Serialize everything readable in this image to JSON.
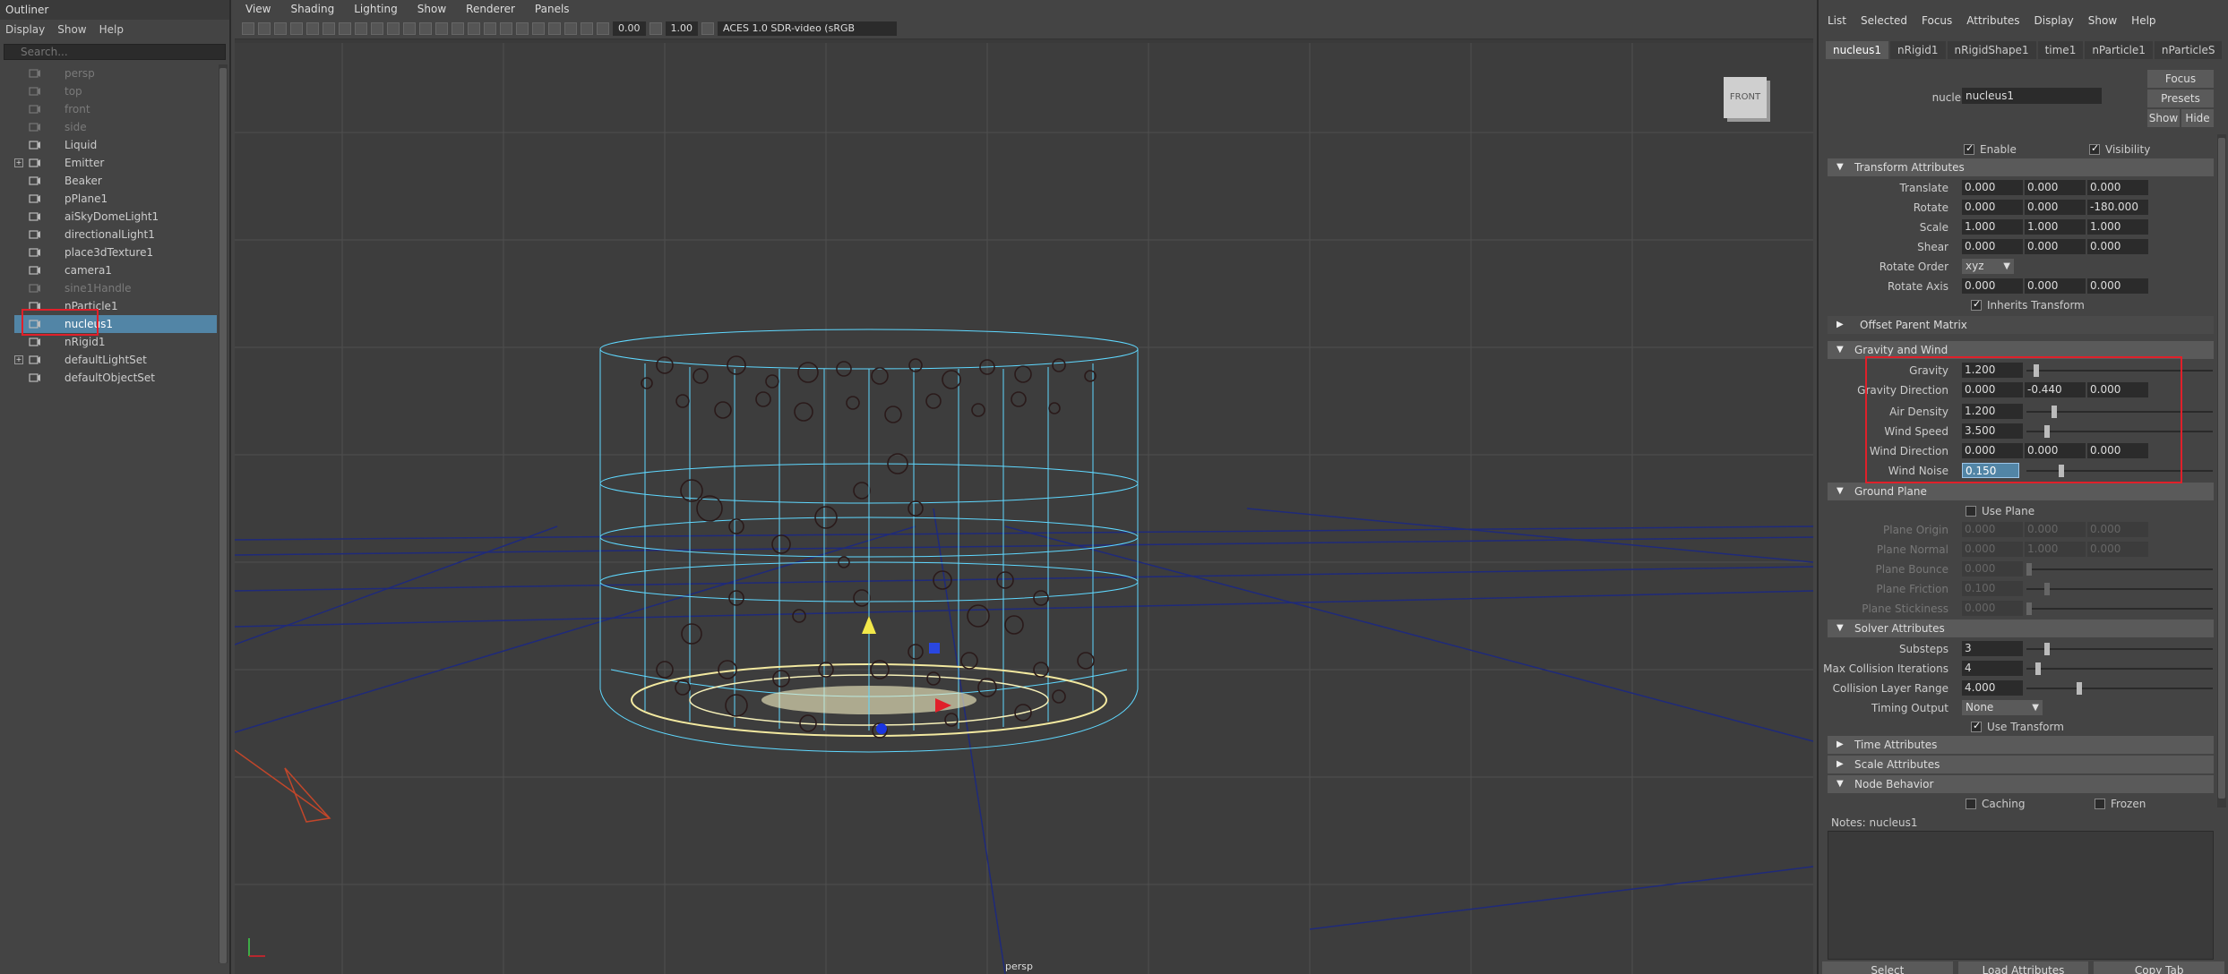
{
  "outliner": {
    "title": "Outliner",
    "menu": [
      "Display",
      "Show",
      "Help"
    ],
    "search_placeholder": "Search...",
    "items": [
      {
        "label": "persp",
        "dim": true,
        "icon": "camera-icon"
      },
      {
        "label": "top",
        "dim": true,
        "icon": "camera-icon"
      },
      {
        "label": "front",
        "dim": true,
        "icon": "camera-icon"
      },
      {
        "label": "side",
        "dim": true,
        "icon": "camera-icon"
      },
      {
        "label": "Liquid",
        "icon": "transform-icon"
      },
      {
        "label": "Emitter",
        "icon": "transform-icon",
        "expander": true
      },
      {
        "label": "Beaker",
        "icon": "transform-icon"
      },
      {
        "label": "pPlane1",
        "icon": "transform-icon"
      },
      {
        "label": "aiSkyDomeLight1",
        "icon": "light-icon"
      },
      {
        "label": "directionalLight1",
        "icon": "light-icon"
      },
      {
        "label": "place3dTexture1",
        "icon": "texture-icon"
      },
      {
        "label": "camera1",
        "icon": "camera-icon"
      },
      {
        "label": "sine1Handle",
        "dim": true,
        "icon": "handle-icon"
      },
      {
        "label": "nParticle1",
        "icon": "particle-icon"
      },
      {
        "label": "nucleus1",
        "icon": "nucleus-icon",
        "selected": true
      },
      {
        "label": "nRigid1",
        "icon": "rigid-icon"
      },
      {
        "label": "defaultLightSet",
        "icon": "set-icon",
        "expander": true
      },
      {
        "label": "defaultObjectSet",
        "icon": "set-icon"
      }
    ]
  },
  "viewport": {
    "menu": [
      "View",
      "Shading",
      "Lighting",
      "Show",
      "Renderer",
      "Panels"
    ],
    "exposure": "0.00",
    "gamma": "1.00",
    "color_space": "ACES 1.0 SDR-video (sRGB",
    "view_cube": "FRONT",
    "camera_label": "persp"
  },
  "attr": {
    "menu": [
      "List",
      "Selected",
      "Focus",
      "Attributes",
      "Display",
      "Show",
      "Help"
    ],
    "tabs": [
      "nucleus1",
      "nRigid1",
      "nRigidShape1",
      "time1",
      "nParticle1",
      "nParticleS"
    ],
    "node_label": "nucleus:",
    "node_name": "nucleus1",
    "buttons": {
      "focus": "Focus",
      "presets": "Presets",
      "show": "Show",
      "hide": "Hide"
    },
    "enable": "Enable",
    "visibility": "Visibility",
    "transform": {
      "title": "Transform Attributes",
      "translate": {
        "label": "Translate",
        "v": [
          "0.000",
          "0.000",
          "0.000"
        ]
      },
      "rotate": {
        "label": "Rotate",
        "v": [
          "0.000",
          "0.000",
          "-180.000"
        ]
      },
      "scale": {
        "label": "Scale",
        "v": [
          "1.000",
          "1.000",
          "1.000"
        ]
      },
      "shear": {
        "label": "Shear",
        "v": [
          "0.000",
          "0.000",
          "0.000"
        ]
      },
      "rotate_order": {
        "label": "Rotate Order",
        "v": "xyz"
      },
      "rotate_axis": {
        "label": "Rotate Axis",
        "v": [
          "0.000",
          "0.000",
          "0.000"
        ]
      },
      "inherits": "Inherits Transform",
      "offset_parent": "Offset Parent Matrix"
    },
    "gravity": {
      "title": "Gravity and Wind",
      "gravity": {
        "label": "Gravity",
        "v": "1.200"
      },
      "gravity_direction": {
        "label": "Gravity Direction",
        "v": [
          "0.000",
          "-0.440",
          "0.000"
        ]
      },
      "air_density": {
        "label": "Air Density",
        "v": "1.200"
      },
      "wind_speed": {
        "label": "Wind Speed",
        "v": "3.500"
      },
      "wind_direction": {
        "label": "Wind Direction",
        "v": [
          "0.000",
          "0.000",
          "0.000"
        ]
      },
      "wind_noise": {
        "label": "Wind Noise",
        "v": "0.150"
      }
    },
    "ground": {
      "title": "Ground Plane",
      "use_plane": "Use Plane",
      "plane_origin": {
        "label": "Plane Origin",
        "v": [
          "0.000",
          "0.000",
          "0.000"
        ]
      },
      "plane_normal": {
        "label": "Plane Normal",
        "v": [
          "0.000",
          "1.000",
          "0.000"
        ]
      },
      "plane_bounce": {
        "label": "Plane Bounce",
        "v": "0.000"
      },
      "plane_friction": {
        "label": "Plane Friction",
        "v": "0.100"
      },
      "plane_stickiness": {
        "label": "Plane Stickiness",
        "v": "0.000"
      }
    },
    "solver": {
      "title": "Solver Attributes",
      "substeps": {
        "label": "Substeps",
        "v": "3"
      },
      "max_collision": {
        "label": "Max Collision Iterations",
        "v": "4"
      },
      "collision_layer": {
        "label": "Collision Layer Range",
        "v": "4.000"
      },
      "timing_output": {
        "label": "Timing Output",
        "v": "None"
      },
      "use_transform": "Use Transform"
    },
    "time_attrs": "Time Attributes",
    "scale_attrs": "Scale Attributes",
    "node_behavior": "Node Behavior",
    "caching": "Caching",
    "frozen": "Frozen",
    "notes": "Notes:  nucleus1",
    "bottom": [
      "Select",
      "Load Attributes",
      "Copy Tab"
    ]
  }
}
